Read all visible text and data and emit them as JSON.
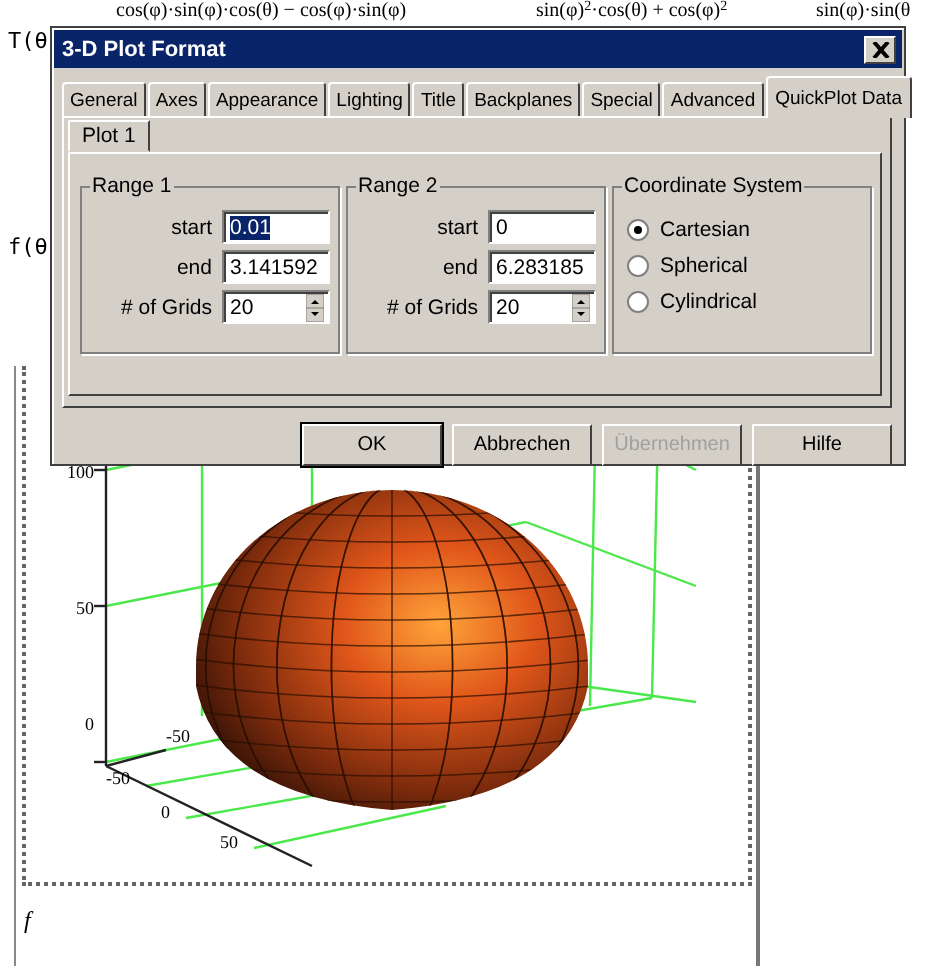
{
  "background": {
    "formulas": [
      "cos(φ)·sin(φ)·cos(θ) − cos(φ)·sin(φ)",
      "sin(φ)$^{2}$·cos(θ) + cos(φ)$^{2}$",
      "sin(φ)·sin(θ"
    ],
    "row_labels": [
      "T(θ",
      "f(θ"
    ],
    "plot": {
      "z_ticks": [
        "100",
        "50",
        "0"
      ],
      "y_ticks": [
        "-50"
      ],
      "x_ticks": [
        "-50",
        "0",
        "50"
      ]
    },
    "plot_label": "f"
  },
  "dialog": {
    "title": "3-D Plot Format",
    "tabs": [
      {
        "label": "General",
        "selected": false
      },
      {
        "label": "Axes",
        "selected": false
      },
      {
        "label": "Appearance",
        "selected": false
      },
      {
        "label": "Lighting",
        "selected": false
      },
      {
        "label": "Title",
        "selected": false
      },
      {
        "label": "Backplanes",
        "selected": false
      },
      {
        "label": "Special",
        "selected": false
      },
      {
        "label": "Advanced",
        "selected": false
      },
      {
        "label": "QuickPlot Data",
        "selected": true
      }
    ],
    "subtabs": [
      {
        "label": "Plot 1",
        "selected": true
      }
    ],
    "ranges": [
      {
        "title": "Range 1",
        "fields": [
          {
            "label": "start",
            "value": "0.01",
            "kind": "text",
            "highlighted": true
          },
          {
            "label": "end",
            "value": "3.141592",
            "kind": "text",
            "highlighted": false
          },
          {
            "label": "# of Grids",
            "value": "20",
            "kind": "spin",
            "highlighted": false
          }
        ]
      },
      {
        "title": "Range 2",
        "fields": [
          {
            "label": "start",
            "value": "0",
            "kind": "text",
            "highlighted": false
          },
          {
            "label": "end",
            "value": "6.283185",
            "kind": "text",
            "highlighted": false
          },
          {
            "label": "# of Grids",
            "value": "20",
            "kind": "spin",
            "highlighted": false
          }
        ]
      }
    ],
    "coordinate_system": {
      "title": "Coordinate System",
      "options": [
        {
          "label": "Cartesian",
          "selected": true
        },
        {
          "label": "Spherical",
          "selected": false
        },
        {
          "label": "Cylindrical",
          "selected": false
        }
      ]
    },
    "buttons": [
      {
        "label": "OK",
        "disabled": false,
        "default": true
      },
      {
        "label": "Abbrechen",
        "disabled": false,
        "default": false
      },
      {
        "label": "Übernehmen",
        "disabled": true,
        "default": false
      },
      {
        "label": "Hilfe",
        "disabled": false,
        "default": false
      }
    ]
  }
}
